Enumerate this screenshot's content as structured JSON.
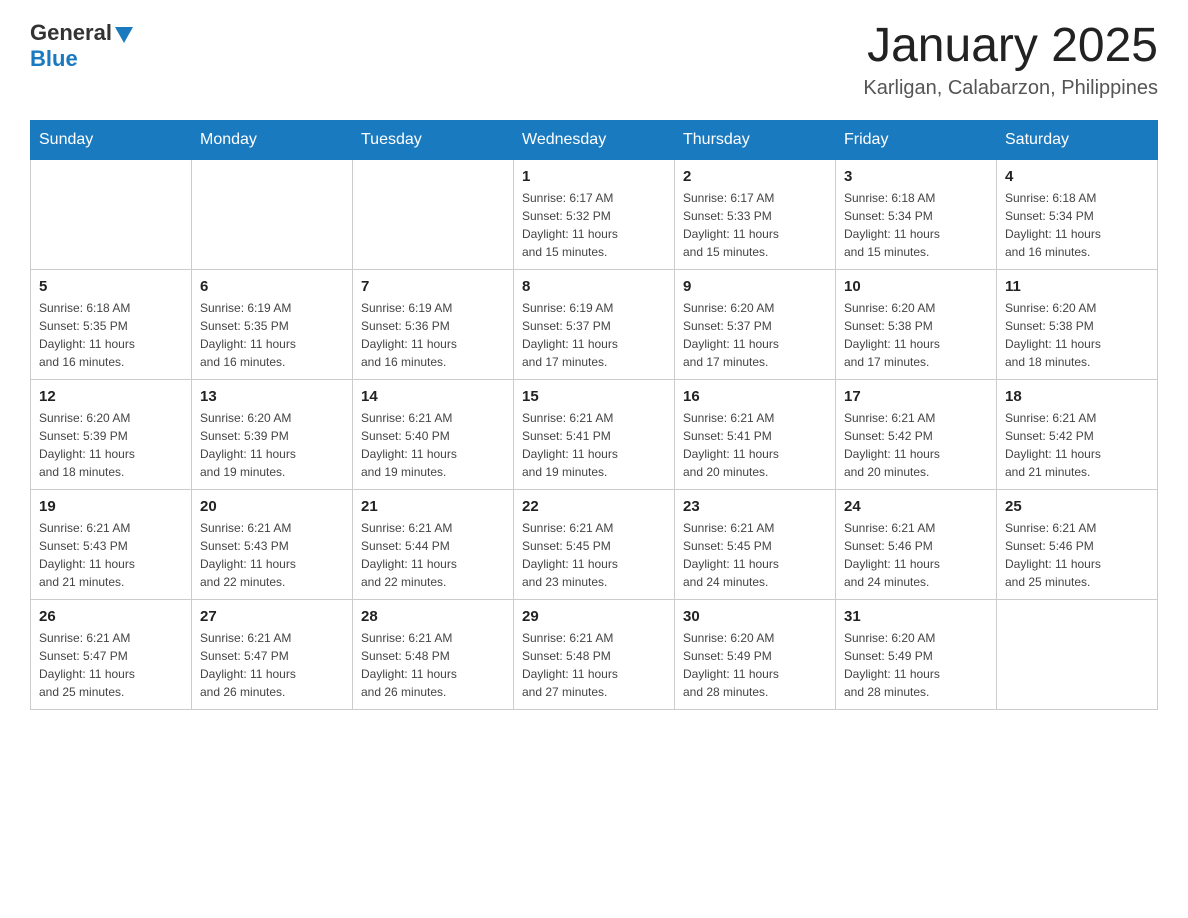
{
  "header": {
    "logo": {
      "general": "General",
      "blue": "Blue"
    },
    "title": "January 2025",
    "subtitle": "Karligan, Calabarzon, Philippines"
  },
  "calendar": {
    "days_of_week": [
      "Sunday",
      "Monday",
      "Tuesday",
      "Wednesday",
      "Thursday",
      "Friday",
      "Saturday"
    ],
    "weeks": [
      [
        {
          "day": "",
          "info": ""
        },
        {
          "day": "",
          "info": ""
        },
        {
          "day": "",
          "info": ""
        },
        {
          "day": "1",
          "info": "Sunrise: 6:17 AM\nSunset: 5:32 PM\nDaylight: 11 hours\nand 15 minutes."
        },
        {
          "day": "2",
          "info": "Sunrise: 6:17 AM\nSunset: 5:33 PM\nDaylight: 11 hours\nand 15 minutes."
        },
        {
          "day": "3",
          "info": "Sunrise: 6:18 AM\nSunset: 5:34 PM\nDaylight: 11 hours\nand 15 minutes."
        },
        {
          "day": "4",
          "info": "Sunrise: 6:18 AM\nSunset: 5:34 PM\nDaylight: 11 hours\nand 16 minutes."
        }
      ],
      [
        {
          "day": "5",
          "info": "Sunrise: 6:18 AM\nSunset: 5:35 PM\nDaylight: 11 hours\nand 16 minutes."
        },
        {
          "day": "6",
          "info": "Sunrise: 6:19 AM\nSunset: 5:35 PM\nDaylight: 11 hours\nand 16 minutes."
        },
        {
          "day": "7",
          "info": "Sunrise: 6:19 AM\nSunset: 5:36 PM\nDaylight: 11 hours\nand 16 minutes."
        },
        {
          "day": "8",
          "info": "Sunrise: 6:19 AM\nSunset: 5:37 PM\nDaylight: 11 hours\nand 17 minutes."
        },
        {
          "day": "9",
          "info": "Sunrise: 6:20 AM\nSunset: 5:37 PM\nDaylight: 11 hours\nand 17 minutes."
        },
        {
          "day": "10",
          "info": "Sunrise: 6:20 AM\nSunset: 5:38 PM\nDaylight: 11 hours\nand 17 minutes."
        },
        {
          "day": "11",
          "info": "Sunrise: 6:20 AM\nSunset: 5:38 PM\nDaylight: 11 hours\nand 18 minutes."
        }
      ],
      [
        {
          "day": "12",
          "info": "Sunrise: 6:20 AM\nSunset: 5:39 PM\nDaylight: 11 hours\nand 18 minutes."
        },
        {
          "day": "13",
          "info": "Sunrise: 6:20 AM\nSunset: 5:39 PM\nDaylight: 11 hours\nand 19 minutes."
        },
        {
          "day": "14",
          "info": "Sunrise: 6:21 AM\nSunset: 5:40 PM\nDaylight: 11 hours\nand 19 minutes."
        },
        {
          "day": "15",
          "info": "Sunrise: 6:21 AM\nSunset: 5:41 PM\nDaylight: 11 hours\nand 19 minutes."
        },
        {
          "day": "16",
          "info": "Sunrise: 6:21 AM\nSunset: 5:41 PM\nDaylight: 11 hours\nand 20 minutes."
        },
        {
          "day": "17",
          "info": "Sunrise: 6:21 AM\nSunset: 5:42 PM\nDaylight: 11 hours\nand 20 minutes."
        },
        {
          "day": "18",
          "info": "Sunrise: 6:21 AM\nSunset: 5:42 PM\nDaylight: 11 hours\nand 21 minutes."
        }
      ],
      [
        {
          "day": "19",
          "info": "Sunrise: 6:21 AM\nSunset: 5:43 PM\nDaylight: 11 hours\nand 21 minutes."
        },
        {
          "day": "20",
          "info": "Sunrise: 6:21 AM\nSunset: 5:43 PM\nDaylight: 11 hours\nand 22 minutes."
        },
        {
          "day": "21",
          "info": "Sunrise: 6:21 AM\nSunset: 5:44 PM\nDaylight: 11 hours\nand 22 minutes."
        },
        {
          "day": "22",
          "info": "Sunrise: 6:21 AM\nSunset: 5:45 PM\nDaylight: 11 hours\nand 23 minutes."
        },
        {
          "day": "23",
          "info": "Sunrise: 6:21 AM\nSunset: 5:45 PM\nDaylight: 11 hours\nand 24 minutes."
        },
        {
          "day": "24",
          "info": "Sunrise: 6:21 AM\nSunset: 5:46 PM\nDaylight: 11 hours\nand 24 minutes."
        },
        {
          "day": "25",
          "info": "Sunrise: 6:21 AM\nSunset: 5:46 PM\nDaylight: 11 hours\nand 25 minutes."
        }
      ],
      [
        {
          "day": "26",
          "info": "Sunrise: 6:21 AM\nSunset: 5:47 PM\nDaylight: 11 hours\nand 25 minutes."
        },
        {
          "day": "27",
          "info": "Sunrise: 6:21 AM\nSunset: 5:47 PM\nDaylight: 11 hours\nand 26 minutes."
        },
        {
          "day": "28",
          "info": "Sunrise: 6:21 AM\nSunset: 5:48 PM\nDaylight: 11 hours\nand 26 minutes."
        },
        {
          "day": "29",
          "info": "Sunrise: 6:21 AM\nSunset: 5:48 PM\nDaylight: 11 hours\nand 27 minutes."
        },
        {
          "day": "30",
          "info": "Sunrise: 6:20 AM\nSunset: 5:49 PM\nDaylight: 11 hours\nand 28 minutes."
        },
        {
          "day": "31",
          "info": "Sunrise: 6:20 AM\nSunset: 5:49 PM\nDaylight: 11 hours\nand 28 minutes."
        },
        {
          "day": "",
          "info": ""
        }
      ]
    ]
  }
}
